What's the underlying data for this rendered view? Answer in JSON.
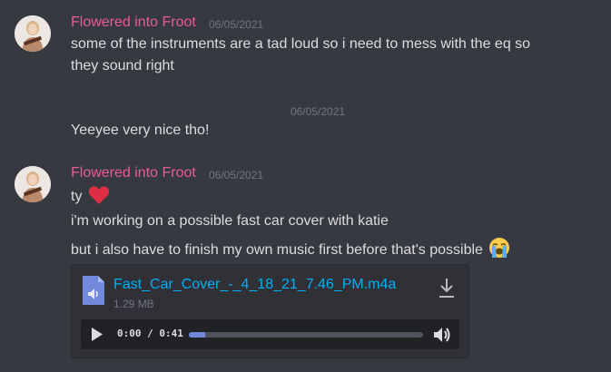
{
  "messages": [
    {
      "author": "Flowered into Froot",
      "timestamp": "06/05/2021",
      "lines": [
        "some of the instruments are a tad loud so i need to mess with the eq so",
        "they sound right"
      ]
    },
    {
      "hover_timestamp": "06/05/2021",
      "text": "Yeeyee very nice tho!"
    },
    {
      "author": "Flowered into Froot",
      "timestamp": "06/05/2021",
      "line1": "ty",
      "line1_emoji": "red-heart-icon",
      "line2": "i'm working on a possible fast car cover with katie",
      "line3": "but i also have to finish my own music first before that's possible",
      "line3_emoji": "loudly-crying-face-icon",
      "attachment": {
        "file_name": "Fast_Car_Cover_-_4_18_21_7.46_PM.m4a",
        "file_size": "1.29 MB",
        "player": {
          "current_time": "0:00",
          "separator": " / ",
          "duration": "0:41",
          "progress_fraction": 0.07
        }
      }
    }
  ],
  "colors": {
    "background": "#36393f",
    "username": "#ea5a9b",
    "link": "#00aff4",
    "attachment_bg": "#2f3136",
    "player_bg": "#202225",
    "progress": "#7289da"
  }
}
